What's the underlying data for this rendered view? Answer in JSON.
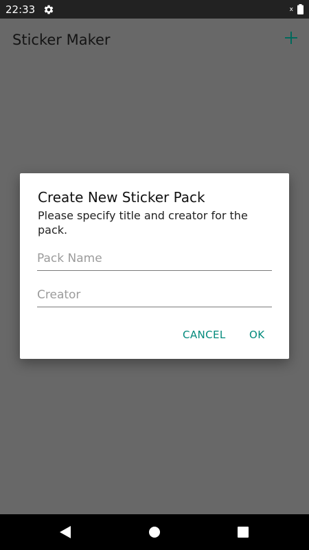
{
  "status_bar": {
    "time": "22:33",
    "settings_icon": "gear-icon",
    "signal_text": "x",
    "battery_icon": "battery-icon"
  },
  "app_bar": {
    "title": "Sticker Maker",
    "add_icon": "plus-icon"
  },
  "dialog": {
    "title": "Create New Sticker Pack",
    "message": "Please specify title and creator for the pack.",
    "pack_name": {
      "value": "",
      "placeholder": "Pack Name"
    },
    "creator": {
      "value": "",
      "placeholder": "Creator"
    },
    "cancel_label": "CANCEL",
    "ok_label": "OK"
  },
  "nav_bar": {
    "back_icon": "back-triangle-icon",
    "home_icon": "home-circle-icon",
    "recents_icon": "recents-square-icon"
  },
  "colors": {
    "accent": "#00897B",
    "scrim": "#686868",
    "status_bar": "#222222",
    "dialog_bg": "#FFFFFF"
  }
}
